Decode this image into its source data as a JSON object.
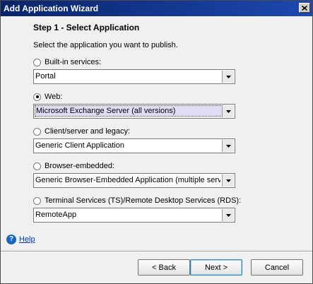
{
  "window": {
    "title": "Add Application Wizard"
  },
  "step": {
    "title": "Step 1 - Select Application",
    "instructions": "Select the application you want to publish."
  },
  "options": [
    {
      "label": "Built-in services:",
      "selected": false,
      "value": "Portal"
    },
    {
      "label": "Web:",
      "selected": true,
      "value": "Microsoft Exchange Server (all versions)"
    },
    {
      "label": "Client/server and legacy:",
      "selected": false,
      "value": "Generic Client Application"
    },
    {
      "label": "Browser-embedded:",
      "selected": false,
      "value": "Generic Browser-Embedded Application (multiple server"
    },
    {
      "label": "Terminal Services (TS)/Remote Desktop Services (RDS):",
      "selected": false,
      "value": "RemoteApp"
    }
  ],
  "help": {
    "label": "Help"
  },
  "buttons": {
    "back": "< Back",
    "next": "Next >",
    "cancel": "Cancel"
  },
  "colors": {
    "titlebar": "#0a246a",
    "selection": "#e0dcf4",
    "link": "#0033cc"
  }
}
